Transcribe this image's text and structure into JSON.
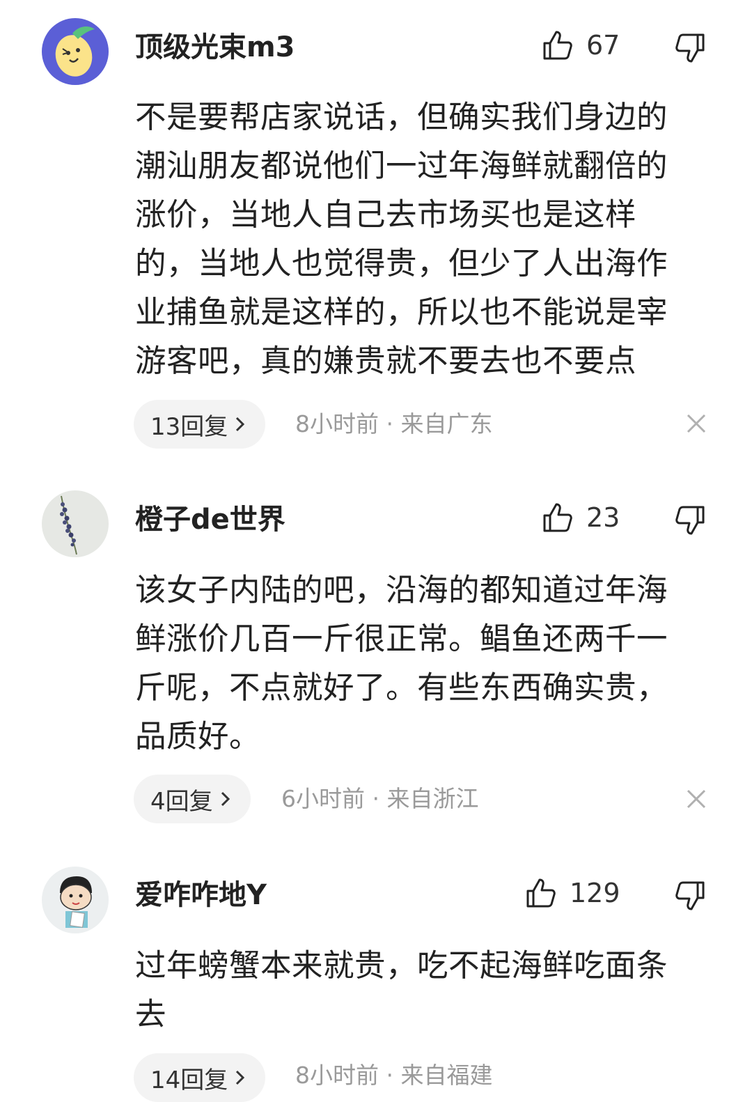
{
  "comments": [
    {
      "username": "顶级光束m3",
      "likes": "67",
      "text": "不是要帮店家说话，但确实我们身边的\n潮汕朋友都说他们一过年海鲜就翻倍的\n涨价，当地人自己去市场买也是这样\n的，当地人也觉得贵，但少了人出海作\n业捕鱼就是这样的，所以也不能说是宰\n游客吧，真的嫌贵就不要去也不要点",
      "replies": "13回复",
      "meta": "8小时前 · 来自广东",
      "avatar_color": "#5b5fd6"
    },
    {
      "username": "橙子de世界",
      "likes": "23",
      "text": "该女子内陆的吧，沿海的都知道过年海\n鲜涨价几百一斤很正常。鲳鱼还两千一\n斤呢，不点就好了。有些东西确实贵，\n品质好。",
      "replies": "4回复",
      "meta": "6小时前 · 来自浙江",
      "avatar_color": "#e6e8e4"
    },
    {
      "username": "爱咋咋地Y",
      "likes": "129",
      "text": "过年螃蟹本来就贵，吃不起海鲜吃面条\n去",
      "replies": "14回复",
      "meta": "8小时前 · 来自福建",
      "avatar_color": "#eceff0"
    }
  ],
  "icons": {
    "like": "thumbs-up-icon",
    "dislike": "thumbs-down-icon",
    "chevron": "chevron-right-icon",
    "close": "close-icon"
  },
  "colors": {
    "text": "#222222",
    "meta": "#9a9a9a",
    "pill_bg": "#f3f3f3"
  }
}
